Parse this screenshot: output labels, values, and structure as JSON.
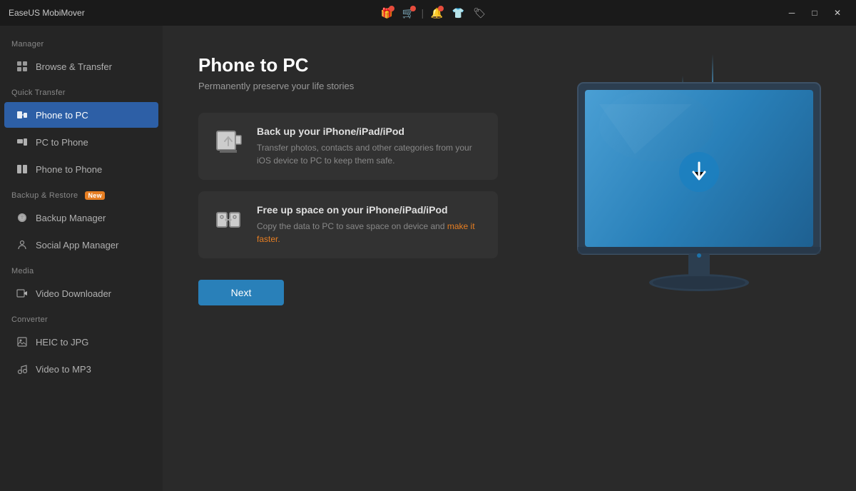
{
  "app": {
    "title": "EaseUS MobiMover"
  },
  "titlebar": {
    "icons": [
      "gift-icon",
      "cart-icon",
      "bell-icon",
      "shirt-icon",
      "discount-icon"
    ],
    "controls": [
      "minimize",
      "maximize",
      "close"
    ]
  },
  "sidebar": {
    "sections": [
      {
        "label": "Manager",
        "items": [
          {
            "id": "browse-transfer",
            "label": "Browse & Transfer",
            "icon": "grid-icon",
            "active": false
          }
        ]
      },
      {
        "label": "Quick Transfer",
        "items": [
          {
            "id": "phone-to-pc",
            "label": "Phone to PC",
            "icon": "phone-pc-icon",
            "active": true
          },
          {
            "id": "pc-to-phone",
            "label": "PC to Phone",
            "icon": "pc-phone-icon",
            "active": false
          },
          {
            "id": "phone-to-phone",
            "label": "Phone to Phone",
            "icon": "phone-phone-icon",
            "active": false
          }
        ]
      },
      {
        "label": "Backup & Restore",
        "label_badge": "New",
        "items": [
          {
            "id": "backup-manager",
            "label": "Backup Manager",
            "icon": "backup-icon",
            "active": false
          },
          {
            "id": "social-app-manager",
            "label": "Social App Manager",
            "icon": "social-icon",
            "active": false
          }
        ]
      },
      {
        "label": "Media",
        "items": [
          {
            "id": "video-downloader",
            "label": "Video Downloader",
            "icon": "video-icon",
            "active": false
          }
        ]
      },
      {
        "label": "Converter",
        "items": [
          {
            "id": "heic-to-jpg",
            "label": "HEIC to JPG",
            "icon": "heic-icon",
            "active": false
          },
          {
            "id": "video-to-mp3",
            "label": "Video to MP3",
            "icon": "mp3-icon",
            "active": false
          }
        ]
      }
    ]
  },
  "content": {
    "page_title": "Phone to PC",
    "page_subtitle": "Permanently preserve your life stories",
    "features": [
      {
        "id": "backup",
        "title": "Back up your iPhone/iPad/iPod",
        "description": "Transfer photos, contacts and other categories from your iOS device to PC to keep them safe.",
        "highlight": ""
      },
      {
        "id": "free-space",
        "title": "Free up space on your iPhone/iPad/iPod",
        "description_before": "Copy the data to PC to save space on device and ",
        "description_highlight": "make it faster.",
        "description_after": ""
      }
    ],
    "next_button": "Next"
  }
}
